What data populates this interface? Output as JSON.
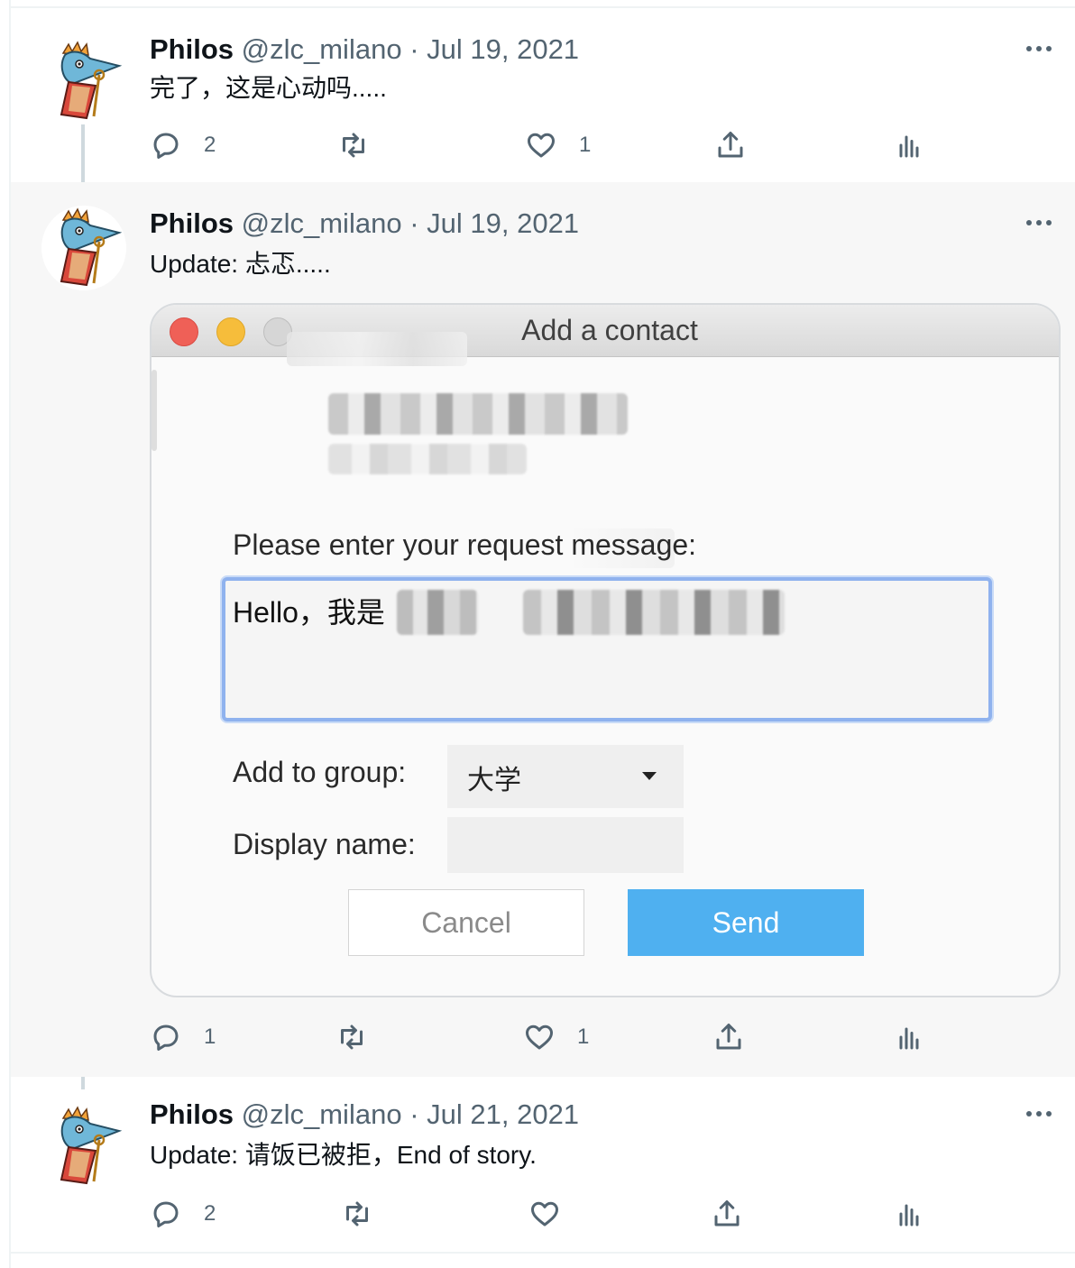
{
  "colors": {
    "accent": "#4fb0f0",
    "thread_line": "#cfd9de",
    "muted_text": "#536471",
    "focus_ring": "#8fb2ee"
  },
  "tweets": [
    {
      "name": "Philos",
      "handle": "@zlc_milano",
      "separator": "·",
      "date": "Jul 19, 2021",
      "text": "完了，这是心动吗.....",
      "reply_count": "2",
      "retweet_count": "",
      "like_count": "1"
    },
    {
      "name": "Philos",
      "handle": "@zlc_milano",
      "separator": "·",
      "date": "Jul 19, 2021",
      "text": "Update:  忐忑.....",
      "reply_count": "1",
      "retweet_count": "",
      "like_count": "1"
    },
    {
      "name": "Philos",
      "handle": "@zlc_milano",
      "separator": "·",
      "date": "Jul 21, 2021",
      "text": "Update: 请饭已被拒，End of story.",
      "reply_count": "2",
      "retweet_count": "",
      "like_count": ""
    }
  ],
  "dialog": {
    "title": "Add a contact",
    "prompt": "Please enter your request message:",
    "message_value": "Hello，我是",
    "group_label": "Add to group:",
    "group_value": "大学",
    "display_name_label": "Display name:",
    "display_name_value": "",
    "cancel_label": "Cancel",
    "send_label": "Send"
  },
  "icons": {
    "reply": "reply-icon",
    "retweet": "retweet-icon",
    "like": "heart-icon",
    "share": "share-icon",
    "analytics": "analytics-icon",
    "more": "more-icon"
  }
}
